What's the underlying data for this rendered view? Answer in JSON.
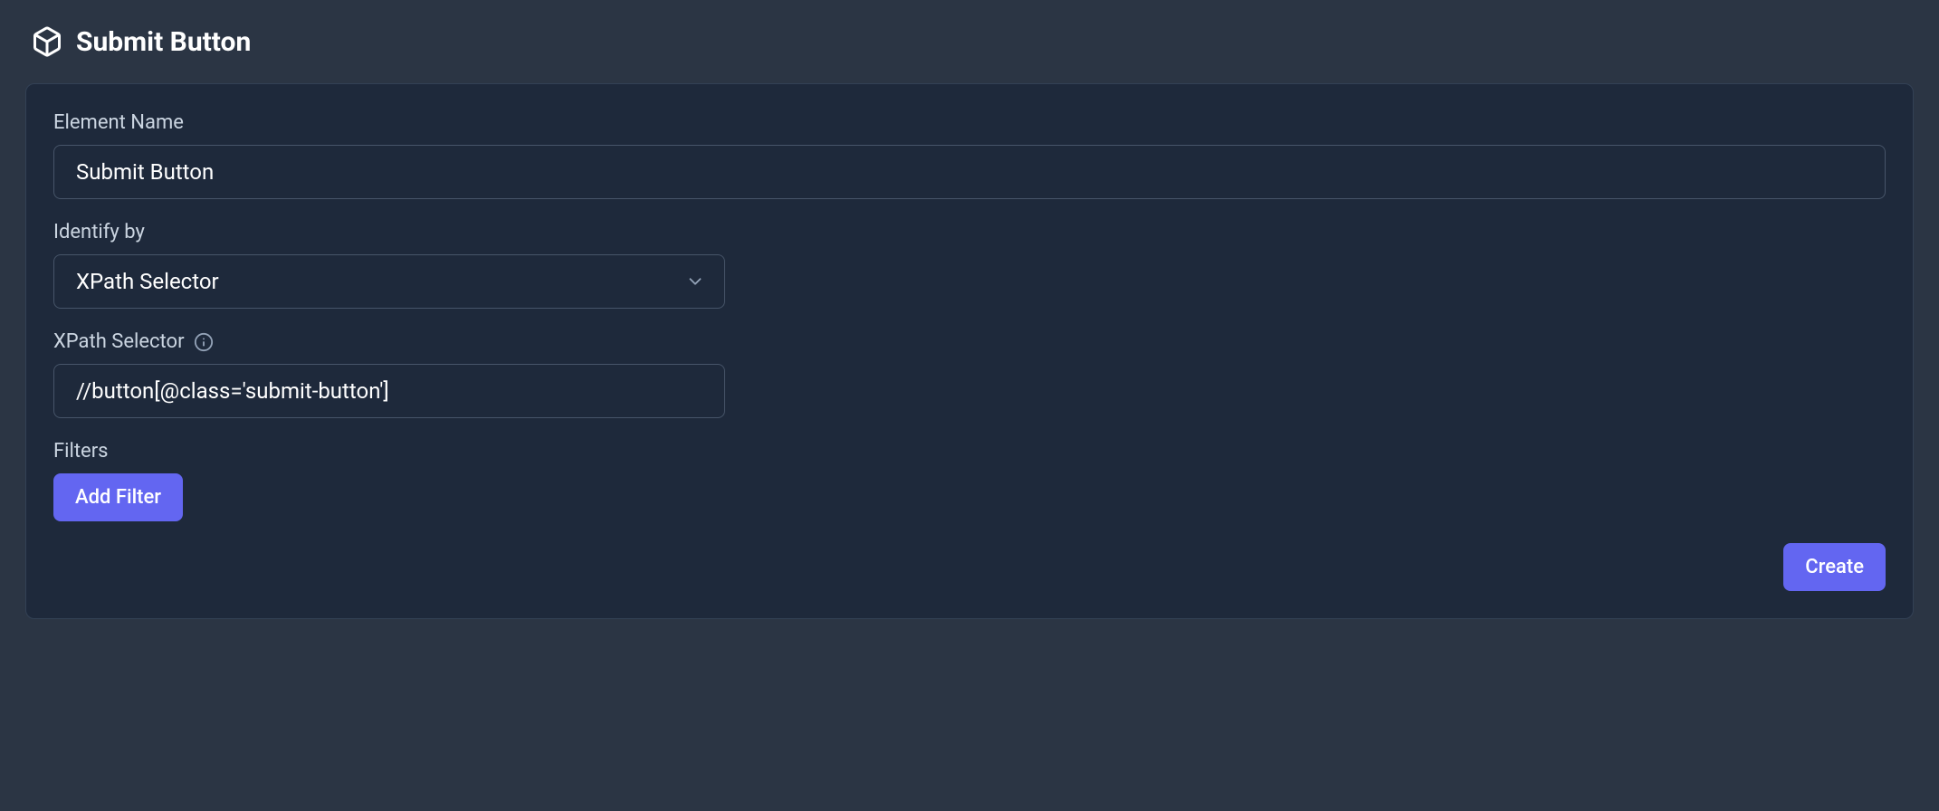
{
  "header": {
    "title": "Submit Button"
  },
  "form": {
    "element_name": {
      "label": "Element Name",
      "value": "Submit Button"
    },
    "identify_by": {
      "label": "Identify by",
      "selected": "XPath Selector"
    },
    "selector": {
      "label": "XPath Selector",
      "value": "//button[@class='submit-button']"
    },
    "filters": {
      "label": "Filters",
      "add_button": "Add Filter"
    },
    "create_button": "Create"
  }
}
